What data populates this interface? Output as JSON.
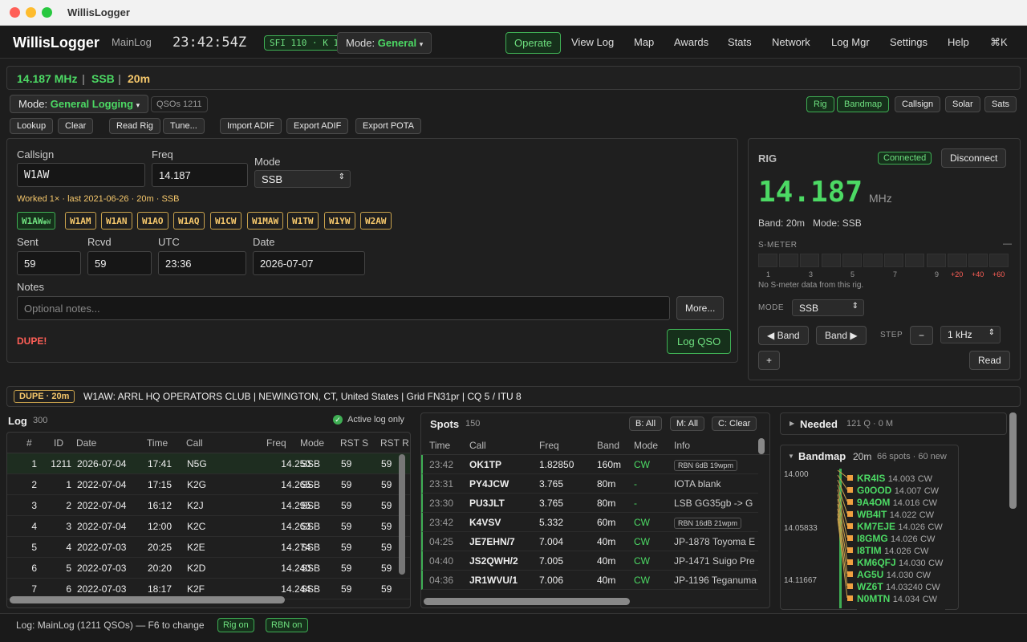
{
  "window": {
    "title": "WillisLogger"
  },
  "nav": {
    "brand": "WillisLogger",
    "log_name": "MainLog",
    "clock": "23:42:54Z",
    "solar": "SFI 110 · K 1",
    "mode_prefix": "Mode: ",
    "mode_value": "General",
    "items": [
      "Operate",
      "View Log",
      "Map",
      "Awards",
      "Stats",
      "Network",
      "Log Mgr",
      "Settings",
      "Help",
      "⌘K"
    ]
  },
  "freqbar": {
    "freq": "14.187 MHz",
    "mode": "SSB",
    "band": "20m"
  },
  "modebar": {
    "mode_prefix": "Mode: ",
    "mode_value": "General Logging",
    "qsos": "QSOs 1211",
    "panel_toggles": [
      "Rig",
      "Bandmap",
      "Callsign",
      "Solar",
      "Sats"
    ]
  },
  "toolbar": [
    "Lookup",
    "Clear",
    "Read Rig",
    "Tune...",
    "Import ADIF",
    "Export ADIF",
    "Export POTA"
  ],
  "entry": {
    "callsign_label": "Callsign",
    "callsign": "W1AW",
    "freq_label": "Freq",
    "freq": "14.187",
    "mode_label": "Mode",
    "mode": "SSB",
    "worked_note": "Worked 1× · last 2021-06-26 · 20m · SSB",
    "partials": [
      "W1AW",
      "W1AM",
      "W1AN",
      "W1AO",
      "W1AQ",
      "W1CW",
      "W1MAW",
      "W1TW",
      "W1YW",
      "W2AW"
    ],
    "partial_active_badge": "●W",
    "sent_label": "Sent",
    "sent": "59",
    "rcvd_label": "Rcvd",
    "rcvd": "59",
    "utc_label": "UTC",
    "utc": "23:36",
    "date_label": "Date",
    "date": "2026-07-07",
    "notes_label": "Notes",
    "notes_placeholder": "Optional notes...",
    "more_button": "More...",
    "dupe_text": "DUPE!",
    "log_button": "Log QSO"
  },
  "rig": {
    "title": "RIG",
    "status": "Connected",
    "disconnect": "Disconnect",
    "freq": "14.187",
    "unit": "MHz",
    "band_mode": "Band: 20m   Mode: SSB",
    "smeter_label": "S-METER",
    "smeter_dash": "—",
    "smeter_scale": [
      "1",
      "3",
      "5",
      "7",
      "9",
      "+20",
      "+40",
      "+60"
    ],
    "smeter_note": "No S-meter data from this rig.",
    "mode_label": "MODE",
    "mode": "SSB",
    "band_down": "◀ Band",
    "band_up": "Band ▶",
    "step_label": "STEP",
    "minus": "−",
    "step": "1 kHz",
    "plus": "+",
    "read": "Read"
  },
  "dupe_banner": {
    "badge": "DUPE · 20m",
    "info": "W1AW: ARRL HQ OPERATORS CLUB | NEWINGTON, CT, United States | Grid FN31pr | CQ 5 / ITU 8"
  },
  "log": {
    "title": "Log",
    "count": "300",
    "active_only": "Active log only",
    "columns": [
      "#",
      "ID",
      "Date",
      "Time",
      "Call",
      "Freq",
      "Mode",
      "RST S",
      "RST R"
    ],
    "rows": [
      [
        "1",
        "1211",
        "2026-07-04",
        "17:41",
        "N5G",
        "14.250",
        "SSB",
        "59",
        "59"
      ],
      [
        "2",
        "1",
        "2022-07-04",
        "17:15",
        "K2G",
        "14.265",
        "SSB",
        "59",
        "59"
      ],
      [
        "3",
        "2",
        "2022-07-04",
        "16:12",
        "K2J",
        "14.295",
        "SSB",
        "59",
        "59"
      ],
      [
        "4",
        "3",
        "2022-07-04",
        "12:00",
        "K2C",
        "14.263",
        "SSB",
        "59",
        "59"
      ],
      [
        "5",
        "4",
        "2022-07-03",
        "20:25",
        "K2E",
        "14.274",
        "SSB",
        "59",
        "59"
      ],
      [
        "6",
        "5",
        "2022-07-03",
        "20:20",
        "K2D",
        "14.240",
        "SSB",
        "59",
        "59"
      ],
      [
        "7",
        "6",
        "2022-07-03",
        "18:17",
        "K2F",
        "14.244",
        "SSB",
        "59",
        "59"
      ]
    ]
  },
  "spots": {
    "title": "Spots",
    "count": "150",
    "filters": [
      "B: All",
      "M: All",
      "C: Clear"
    ],
    "columns": [
      "Time",
      "Call",
      "Freq",
      "Band",
      "Mode",
      "Info"
    ],
    "rows": [
      {
        "time": "23:42",
        "call": "OK1TP",
        "freq": "1.82850",
        "band": "160m",
        "mode": "CW",
        "info": "RBN 6dB 19wpm",
        "tag": true
      },
      {
        "time": "23:31",
        "call": "PY4JCW",
        "freq": "3.765",
        "band": "80m",
        "mode": "-",
        "info": "IOTA blank",
        "tag": false
      },
      {
        "time": "23:30",
        "call": "PU3JLT",
        "freq": "3.765",
        "band": "80m",
        "mode": "-",
        "info": "LSB GG35gb -> G",
        "tag": false
      },
      {
        "time": "23:42",
        "call": "K4VSV",
        "freq": "5.332",
        "band": "60m",
        "mode": "CW",
        "info": "RBN 16dB 21wpm",
        "tag": true
      },
      {
        "time": "04:25",
        "call": "JE7EHN/7",
        "freq": "7.004",
        "band": "40m",
        "mode": "CW",
        "info": "JP-1878 Toyoma E",
        "tag": false
      },
      {
        "time": "04:40",
        "call": "JS2QWH/2",
        "freq": "7.005",
        "band": "40m",
        "mode": "CW",
        "info": "JP-1471 Suigo Pre",
        "tag": false
      },
      {
        "time": "04:36",
        "call": "JR1WVU/1",
        "freq": "7.006",
        "band": "40m",
        "mode": "CW",
        "info": "JP-1196 Teganuma",
        "tag": false
      }
    ]
  },
  "needed": {
    "title": "Needed",
    "summary": "121 Q · 0 M"
  },
  "bandmap": {
    "title": "Bandmap",
    "band": "20m",
    "summary": "66 spots · 60 new",
    "scale": [
      "14.000",
      "14.05833",
      "14.11667"
    ],
    "spots": [
      {
        "call": "KR4IS",
        "freq": "14.003",
        "mode": "CW"
      },
      {
        "call": "G0OOD",
        "freq": "14.007",
        "mode": "CW"
      },
      {
        "call": "9A4OM",
        "freq": "14.016",
        "mode": "CW"
      },
      {
        "call": "WB4IT",
        "freq": "14.022",
        "mode": "CW"
      },
      {
        "call": "KM7EJE",
        "freq": "14.026",
        "mode": "CW"
      },
      {
        "call": "I8GMG",
        "freq": "14.026",
        "mode": "CW"
      },
      {
        "call": "I8TIM",
        "freq": "14.026",
        "mode": "CW"
      },
      {
        "call": "KM6QFJ",
        "freq": "14.030",
        "mode": "CW"
      },
      {
        "call": "AG5U",
        "freq": "14.030",
        "mode": "CW"
      },
      {
        "call": "WZ6T",
        "freq": "14.03240",
        "mode": "CW"
      },
      {
        "call": "N0MTN",
        "freq": "14.034",
        "mode": "CW"
      }
    ]
  },
  "status": {
    "log": "Log: MainLog (1211 QSOs) — F6 to change",
    "rig": "Rig on",
    "rbn": "RBN on"
  },
  "colors": {
    "accent_green": "#4cd964",
    "warning_yellow": "#f5c76b",
    "dupe_red": "#ff5f57"
  }
}
